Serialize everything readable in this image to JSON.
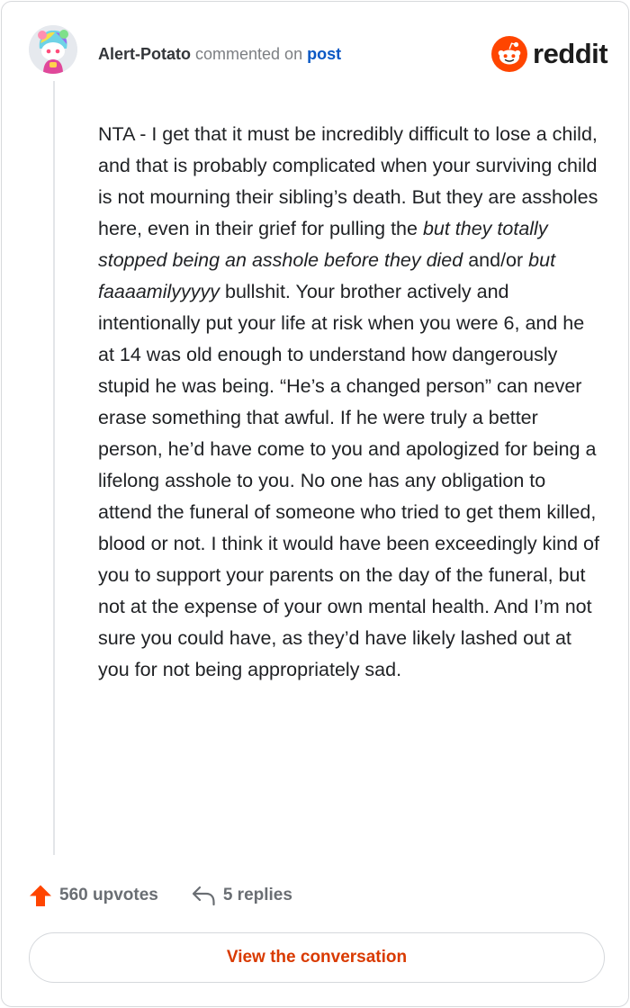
{
  "header": {
    "username": "Alert-Potato",
    "action_text": "commented on",
    "post_link": "post",
    "brand_name": "reddit"
  },
  "comment": {
    "p1": "NTA - I get that it must be incredibly difficult to lose a child, and that is probably complicated when your surviving child is not mourning their sibling’s death. But they are assholes here, even in their grief for pulling the ",
    "italic1": "but they totally stopped being an asshole before they died",
    "p2": " and/or ",
    "italic2": "but faaaamilyyyyy",
    "p3": " bullshit. Your brother actively and intentionally put your life at risk when you were 6, and he at 14 was old enough to understand how dangerously stupid he was being. “He’s a changed person” can never erase something that awful. If he were truly a better person, he’d have come to you and apologized for being a lifelong asshole to you. No one has any obligation to attend the funeral of someone who tried to get them killed, blood or not. I think it would have been exceedingly kind of you to support your parents on the day of the funeral, but not at the expense of your own mental health. And I’m not sure you could have, as they’d have likely lashed out at you for not being appropriately sad."
  },
  "actions": {
    "upvotes_label": "560 upvotes",
    "replies_label": "5 replies"
  },
  "cta": {
    "label": "View the conversation"
  },
  "colors": {
    "brand_orange": "#ff4500",
    "cta_text": "#d93a00",
    "link_blue": "#0a58c4"
  },
  "icons": {
    "avatar": "snoo-avatar",
    "brand": "reddit-logo-icon",
    "upvote": "upvote-arrow-icon",
    "reply": "reply-arrow-icon"
  }
}
